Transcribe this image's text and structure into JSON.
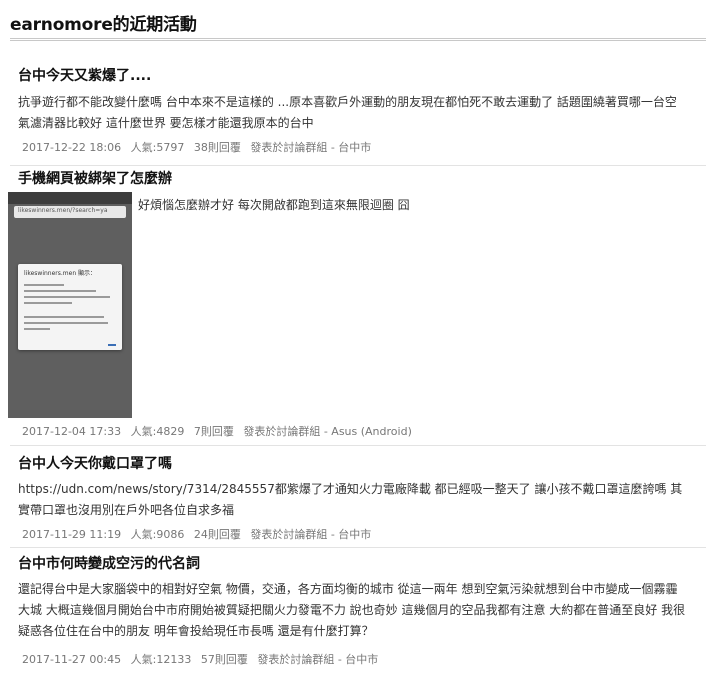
{
  "header": {
    "title": "earnomore的近期活動"
  },
  "posts": [
    {
      "title": "台中今天又紫爆了....",
      "body": "抗爭遊行都不能改變什麼嗎 台中本來不是這樣的 ...原本喜歡戶外運動的朋友現在都怕死不敢去運動了 話題圍繞著買哪一台空氣濾清器比較好 這什麼世界 要怎樣才能還我原本的台中",
      "date": "2017-12-22 18:06",
      "views": "人氣:5797",
      "replies": "38則回覆",
      "group": "發表於討論群組 - 台中市"
    },
    {
      "title": "手機網頁被綁架了怎麼辦",
      "body": "好煩惱怎麼辦才好 每次開啟都跑到這來無限迴圈 囧",
      "thumb_url_text": "likeswinners.men/?search=ya",
      "thumb_dialog_title": "likeswinners.men 顯示：",
      "date": "2017-12-04 17:33",
      "views": "人氣:4829",
      "replies": "7則回覆",
      "group": "發表於討論群組 - Asus (Android)"
    },
    {
      "title": "台中人今天你戴口罩了嗎",
      "body": "https://udn.com/news/story/7314/2845557都紫爆了才通知火力電廠降載 都已經吸一整天了 讓小孩不戴口罩這麼誇嗎 其實帶口罩也沒用別在戶外吧各位自求多福",
      "date": "2017-11-29 11:19",
      "views": "人氣:9086",
      "replies": "24則回覆",
      "group": "發表於討論群組 - 台中市"
    },
    {
      "title": "台中市何時變成空污的代名詞",
      "body": "還記得台中是大家腦袋中的相對好空氣 物價，交通，各方面均衡的城市 從這一兩年 想到空氣污染就想到台中市變成一個霧霾大城 大概這幾個月開始台中市府開始被質疑把關火力發電不力 說也奇妙 這幾個月的空品我都有注意 大約都在普通至良好 我很疑惑各位住在台中的朋友 明年會投給現任市長嗎 還是有什麼打算？",
      "date": "2017-11-27 00:45",
      "views": "人氣:12133",
      "replies": "57則回覆",
      "group": "發表於討論群組 - 台中市"
    }
  ]
}
